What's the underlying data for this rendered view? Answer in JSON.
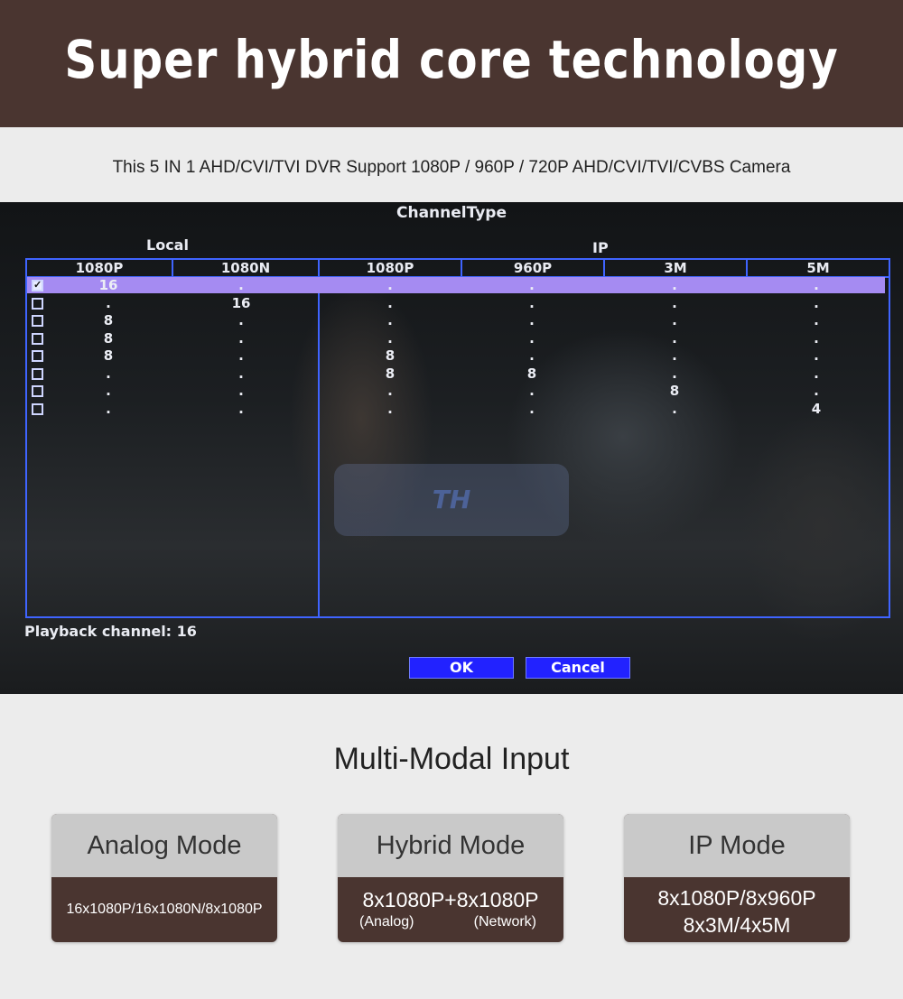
{
  "banner": {
    "title": "Super hybrid core technology"
  },
  "subtitle": "This 5 IN 1 AHD/CVI/TVI DVR Support 1080P / 960P / 720P AHD/CVI/TVI/CVBS Camera",
  "dvr": {
    "window_title": "ChannelType",
    "local_label": "Local",
    "ip_label": "IP",
    "local_columns": [
      "1080P",
      "1080N"
    ],
    "ip_columns": [
      "1080P",
      "960P",
      "3M",
      "5M"
    ],
    "rows": [
      {
        "checked": true,
        "values": [
          "16",
          ".",
          ".",
          ".",
          ".",
          "."
        ]
      },
      {
        "checked": false,
        "values": [
          ".",
          "16",
          ".",
          ".",
          ".",
          "."
        ]
      },
      {
        "checked": false,
        "values": [
          "8",
          ".",
          ".",
          ".",
          ".",
          "."
        ]
      },
      {
        "checked": false,
        "values": [
          "8",
          ".",
          ".",
          ".",
          ".",
          "."
        ]
      },
      {
        "checked": false,
        "values": [
          "8",
          ".",
          "8",
          ".",
          ".",
          "."
        ]
      },
      {
        "checked": false,
        "values": [
          ".",
          ".",
          "8",
          "8",
          ".",
          "."
        ]
      },
      {
        "checked": false,
        "values": [
          ".",
          ".",
          ".",
          ".",
          "8",
          "."
        ]
      },
      {
        "checked": false,
        "values": [
          ".",
          ".",
          ".",
          ".",
          ".",
          "4"
        ]
      }
    ],
    "playback_label": "Playback channel: 16",
    "ok_label": "OK",
    "cancel_label": "Cancel",
    "checkbox_icon": "checkbox-icon"
  },
  "modes": {
    "title": "Multi-Modal Input",
    "analog": {
      "title": "Analog Mode",
      "desc": "16x1080P/16x1080N/8x1080P"
    },
    "hybrid": {
      "title": "Hybrid Mode",
      "desc": "8x1080P+8x1080P",
      "sub_left": "(Analog)",
      "sub_right": "(Network)"
    },
    "ip": {
      "title": "IP  Mode",
      "line1": "8x1080P/8x960P",
      "line2": "8x3M/4x5M"
    }
  },
  "colors": {
    "brown": "#4a3530",
    "dvr_blue": "#3f64ff",
    "highlight": "#a58bf2",
    "button": "#2222ff"
  }
}
